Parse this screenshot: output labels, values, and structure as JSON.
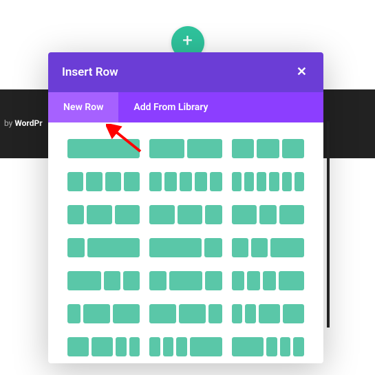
{
  "footer": {
    "prefix": "by ",
    "brand": "WordPr"
  },
  "add_button": {
    "glyph": "+"
  },
  "modal": {
    "title": "Insert Row",
    "close_glyph": "✕",
    "tabs": {
      "new": "New Row",
      "library": "Add From Library"
    }
  },
  "layouts": [
    [
      1
    ],
    [
      1,
      1
    ],
    [
      1,
      1,
      1
    ],
    [
      1,
      1,
      1,
      1
    ],
    [
      1,
      1,
      1,
      1,
      1
    ],
    [
      1,
      1,
      1,
      1,
      1,
      1
    ],
    [
      2,
      3,
      3
    ],
    [
      3,
      3,
      2
    ],
    [
      3,
      2,
      3
    ],
    [
      1,
      3
    ],
    [
      3,
      1
    ],
    [
      1,
      1,
      2
    ],
    [
      2,
      1,
      1
    ],
    [
      1,
      2,
      1
    ],
    [
      1,
      1,
      1,
      2
    ],
    [
      1,
      2,
      2
    ],
    [
      2,
      2,
      1
    ],
    [
      1,
      1,
      2,
      2
    ],
    [
      2,
      2,
      1,
      1
    ],
    [
      1,
      1,
      1,
      3
    ],
    [
      3,
      1,
      1,
      1
    ]
  ],
  "arrow": {
    "color": "#ff0000"
  }
}
